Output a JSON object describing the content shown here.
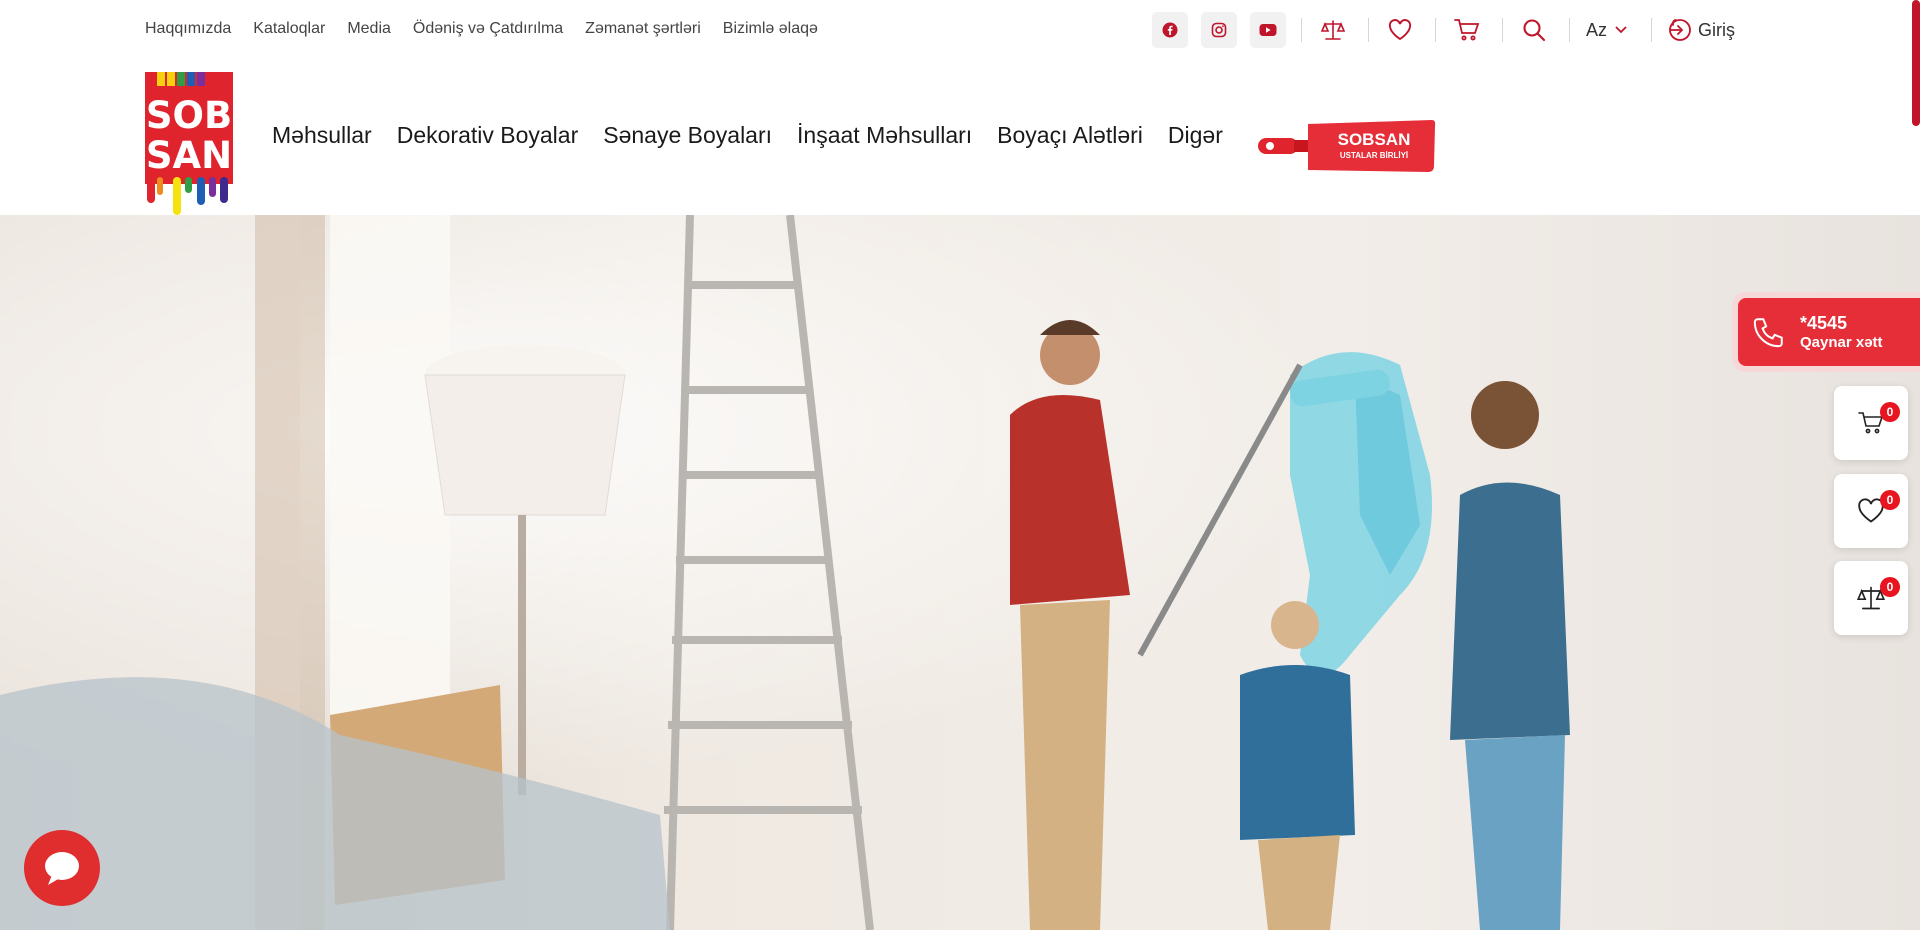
{
  "colors": {
    "brand_red": "#e52e38",
    "dark_red": "#c0162b",
    "text": "#222222"
  },
  "top_links": [
    "Haqqımızda",
    "Kataloqlar",
    "Media",
    "Ödəniş və Çatdırılma",
    "Zəmanət şərtləri",
    "Bizimlə əlaqə"
  ],
  "top_icons": [
    "facebook-icon",
    "instagram-icon",
    "youtube-icon",
    "compare-scale-icon",
    "heart-icon",
    "cart-icon",
    "search-icon"
  ],
  "language": {
    "selected": "Az"
  },
  "login": {
    "label": "Giriş"
  },
  "logo": {
    "line1": "SOB",
    "line2": "SAN"
  },
  "main_nav": [
    "Məhsullar",
    "Dekorativ Boyalar",
    "Sənaye Boyaları",
    "İnşaat Məhsulları",
    "Boyaçı Alətləri",
    "Digər"
  ],
  "masters_badge": {
    "title": "SOBSAN",
    "subtitle": "USTALAR BİRLİYİ"
  },
  "hotline": {
    "number": "*4545",
    "label": "Qaynar xətt"
  },
  "floating": {
    "cart_count": "0",
    "wishlist_count": "0",
    "compare_count": "0"
  }
}
